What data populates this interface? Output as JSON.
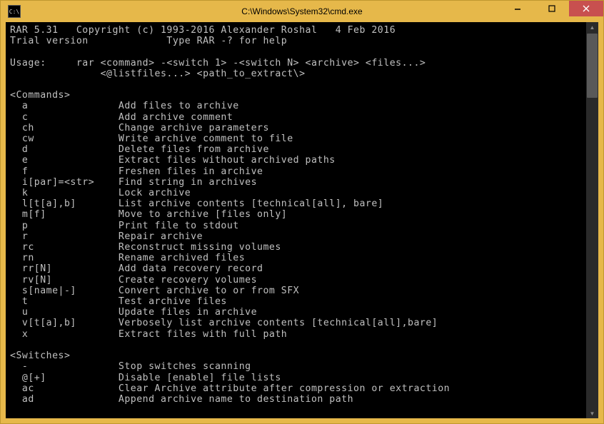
{
  "window": {
    "title": "C:\\Windows\\System32\\cmd.exe",
    "icon_label": "C:\\"
  },
  "terminal": {
    "header_line1": "RAR 5.31   Copyright (c) 1993-2016 Alexander Roshal   4 Feb 2016",
    "header_line2": "Trial version             Type RAR -? for help",
    "blank": "",
    "usage_line1": "Usage:     rar <command> -<switch 1> -<switch N> <archive> <files...>",
    "usage_line2": "               <@listfiles...> <path_to_extract\\>",
    "commands_header": "<Commands>",
    "commands": [
      {
        "cmd": "a",
        "desc": "Add files to archive"
      },
      {
        "cmd": "c",
        "desc": "Add archive comment"
      },
      {
        "cmd": "ch",
        "desc": "Change archive parameters"
      },
      {
        "cmd": "cw",
        "desc": "Write archive comment to file"
      },
      {
        "cmd": "d",
        "desc": "Delete files from archive"
      },
      {
        "cmd": "e",
        "desc": "Extract files without archived paths"
      },
      {
        "cmd": "f",
        "desc": "Freshen files in archive"
      },
      {
        "cmd": "i[par]=<str>",
        "desc": "Find string in archives"
      },
      {
        "cmd": "k",
        "desc": "Lock archive"
      },
      {
        "cmd": "l[t[a],b]",
        "desc": "List archive contents [technical[all], bare]"
      },
      {
        "cmd": "m[f]",
        "desc": "Move to archive [files only]"
      },
      {
        "cmd": "p",
        "desc": "Print file to stdout"
      },
      {
        "cmd": "r",
        "desc": "Repair archive"
      },
      {
        "cmd": "rc",
        "desc": "Reconstruct missing volumes"
      },
      {
        "cmd": "rn",
        "desc": "Rename archived files"
      },
      {
        "cmd": "rr[N]",
        "desc": "Add data recovery record"
      },
      {
        "cmd": "rv[N]",
        "desc": "Create recovery volumes"
      },
      {
        "cmd": "s[name|-]",
        "desc": "Convert archive to or from SFX"
      },
      {
        "cmd": "t",
        "desc": "Test archive files"
      },
      {
        "cmd": "u",
        "desc": "Update files in archive"
      },
      {
        "cmd": "v[t[a],b]",
        "desc": "Verbosely list archive contents [technical[all],bare]"
      },
      {
        "cmd": "x",
        "desc": "Extract files with full path"
      }
    ],
    "switches_header": "<Switches>",
    "switches": [
      {
        "cmd": "-",
        "desc": "Stop switches scanning"
      },
      {
        "cmd": "@[+]",
        "desc": "Disable [enable] file lists"
      },
      {
        "cmd": "ac",
        "desc": "Clear Archive attribute after compression or extraction"
      },
      {
        "cmd": "ad",
        "desc": "Append archive name to destination path"
      }
    ]
  }
}
